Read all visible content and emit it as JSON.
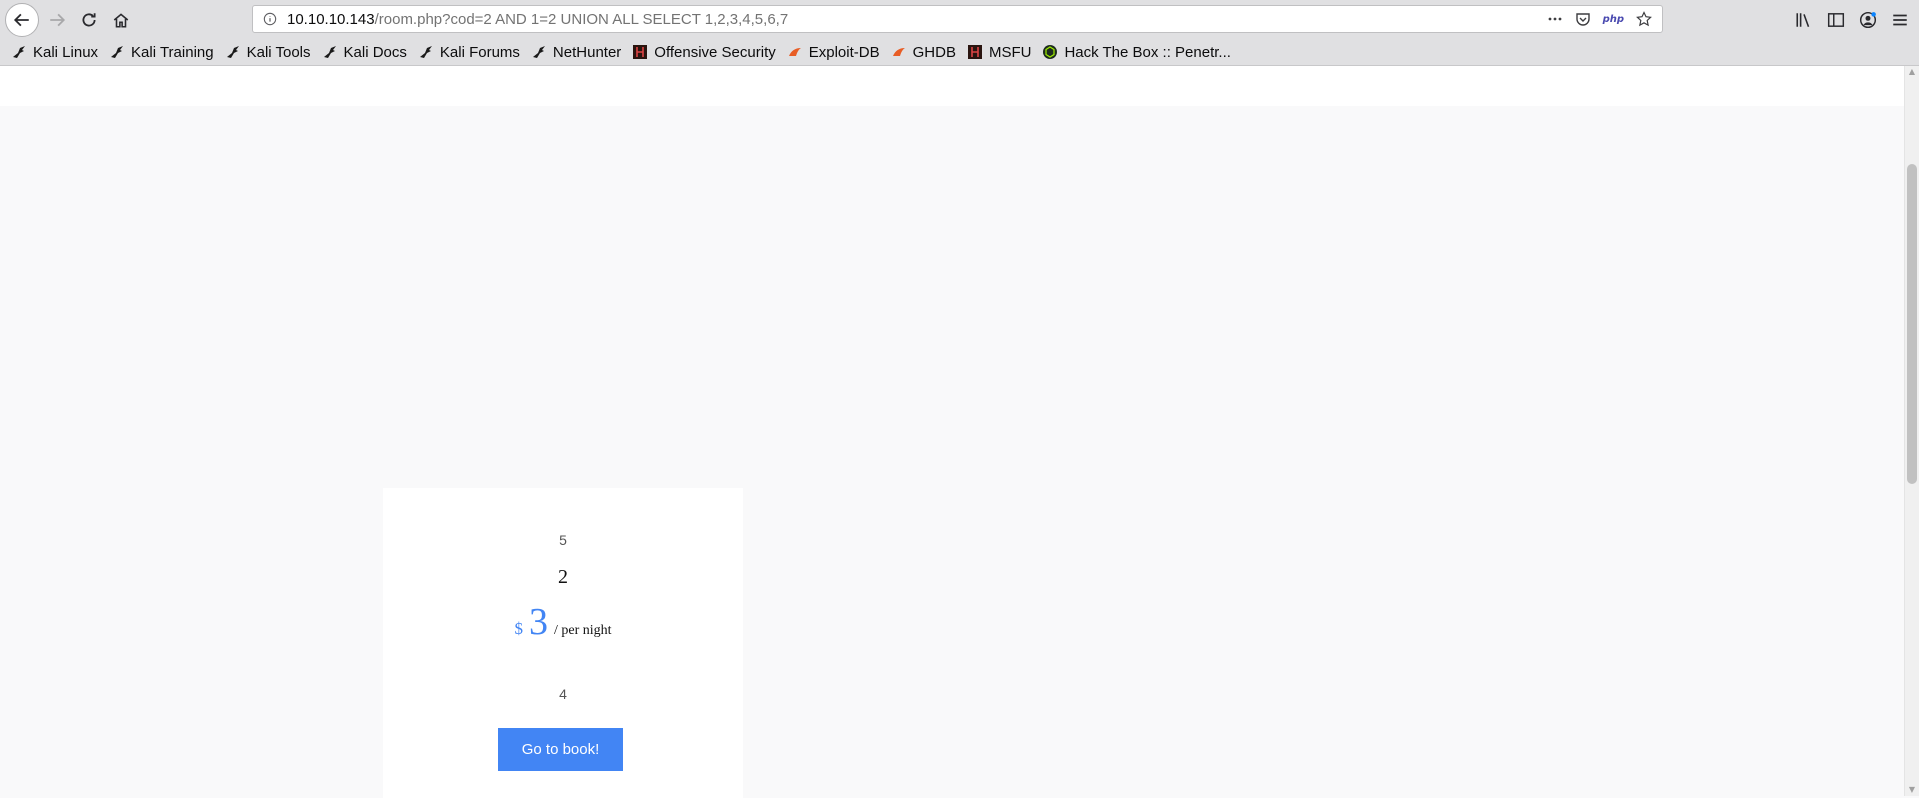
{
  "browser": {
    "url_host": "10.10.10.143",
    "url_path": "/room.php?cod=2 AND 1=2 UNION ALL SELECT 1,2,3,4,5,6,7",
    "php_badge": "php"
  },
  "bookmarks": [
    {
      "label": "Kali Linux",
      "icon": "kali-dragon-icon"
    },
    {
      "label": "Kali Training",
      "icon": "kali-dragon-icon"
    },
    {
      "label": "Kali Tools",
      "icon": "kali-dragon-icon"
    },
    {
      "label": "Kali Docs",
      "icon": "kali-dragon-icon"
    },
    {
      "label": "Kali Forums",
      "icon": "kali-dragon-icon"
    },
    {
      "label": "NetHunter",
      "icon": "kali-dragon-icon"
    },
    {
      "label": "Offensive Security",
      "icon": "offsec-icon"
    },
    {
      "label": "Exploit-DB",
      "icon": "exploitdb-icon"
    },
    {
      "label": "GHDB",
      "icon": "exploitdb-icon"
    },
    {
      "label": "MSFU",
      "icon": "offsec-icon"
    },
    {
      "label": "Hack The Box :: Penetr...",
      "icon": "htb-icon"
    }
  ],
  "room": {
    "meta": "5",
    "name": "2",
    "currency": "$",
    "price": "3",
    "price_unit": "/ per night",
    "description": "4",
    "book_label": "Go to book!"
  },
  "colors": {
    "accent": "#4285f4",
    "chrome": "#e0e0e2",
    "page_bg": "#f9f9fa"
  }
}
